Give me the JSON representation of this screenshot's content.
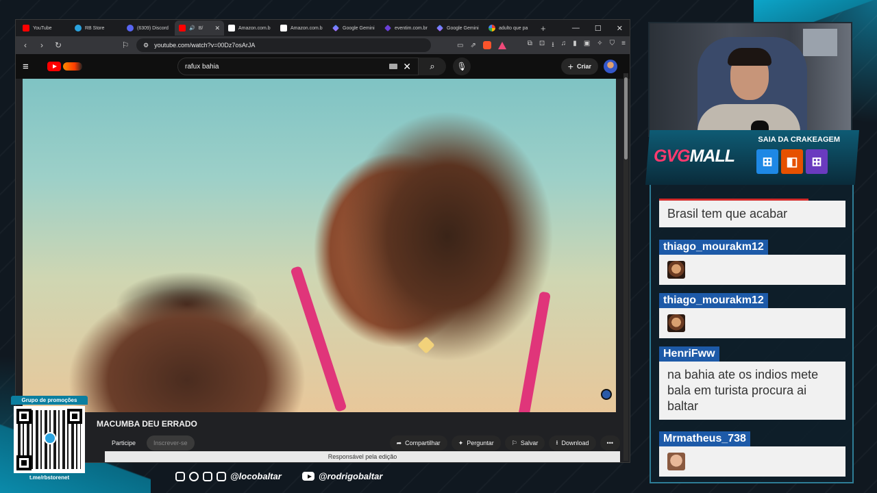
{
  "browser": {
    "tabs": [
      {
        "label": "YouTube",
        "favicon": "youtube-icon",
        "active": false
      },
      {
        "label": "RB Store",
        "favicon": "telegram-icon",
        "active": false
      },
      {
        "label": "(6309) Discord",
        "favicon": "discord-icon",
        "active": false
      },
      {
        "label": "B/",
        "favicon": "youtube-icon",
        "active": true
      },
      {
        "label": "Amazon.com.b",
        "favicon": "amazon-icon",
        "active": false
      },
      {
        "label": "Amazon.com.b",
        "favicon": "amazon-icon",
        "active": false
      },
      {
        "label": "Google Gemini",
        "favicon": "gemini-icon",
        "active": false
      },
      {
        "label": "eventim.com.br",
        "favicon": "eventim-icon",
        "active": false
      },
      {
        "label": "Google Gemini",
        "favicon": "gemini-icon",
        "active": false
      },
      {
        "label": "adulto que pa",
        "favicon": "google-icon",
        "active": false
      }
    ],
    "url": "youtube.com/watch?v=00Dz7osArJA"
  },
  "youtube": {
    "search_value": "rafux bahia",
    "create_label": "Criar",
    "video_title": "MACUMBA DEU ERRADO",
    "actions": {
      "join": "Participe",
      "subscribe": "Inscrever-se",
      "share": "Compartilhar",
      "ask": "Perguntar",
      "save": "Salvar",
      "download": "Download"
    },
    "credit": "Responsável pela edição"
  },
  "ad": {
    "logo_left": "GVG",
    "logo_right": "MALL",
    "slogan": "SAIA DA CRAKEAGEM"
  },
  "chat": {
    "messages": [
      {
        "user": "",
        "text": "Brasil tem que acabar"
      },
      {
        "user": "thiago_mourakm12",
        "text": "",
        "emote": "laughing-face-emote"
      },
      {
        "user": "thiago_mourakm12",
        "text": "",
        "emote": "laughing-face-emote"
      },
      {
        "user": "HenriFww",
        "text": "na bahia ate os indios mete bala em turista procura ai baltar"
      },
      {
        "user": "Mrmatheus_738",
        "text": "",
        "emote": "face-emote"
      }
    ]
  },
  "promo": {
    "title": "Grupo de promoções",
    "url": "t.me/rbstorenet"
  },
  "social": {
    "handle1": "@locobaltar",
    "handle2": "@rodrigobaltar"
  }
}
